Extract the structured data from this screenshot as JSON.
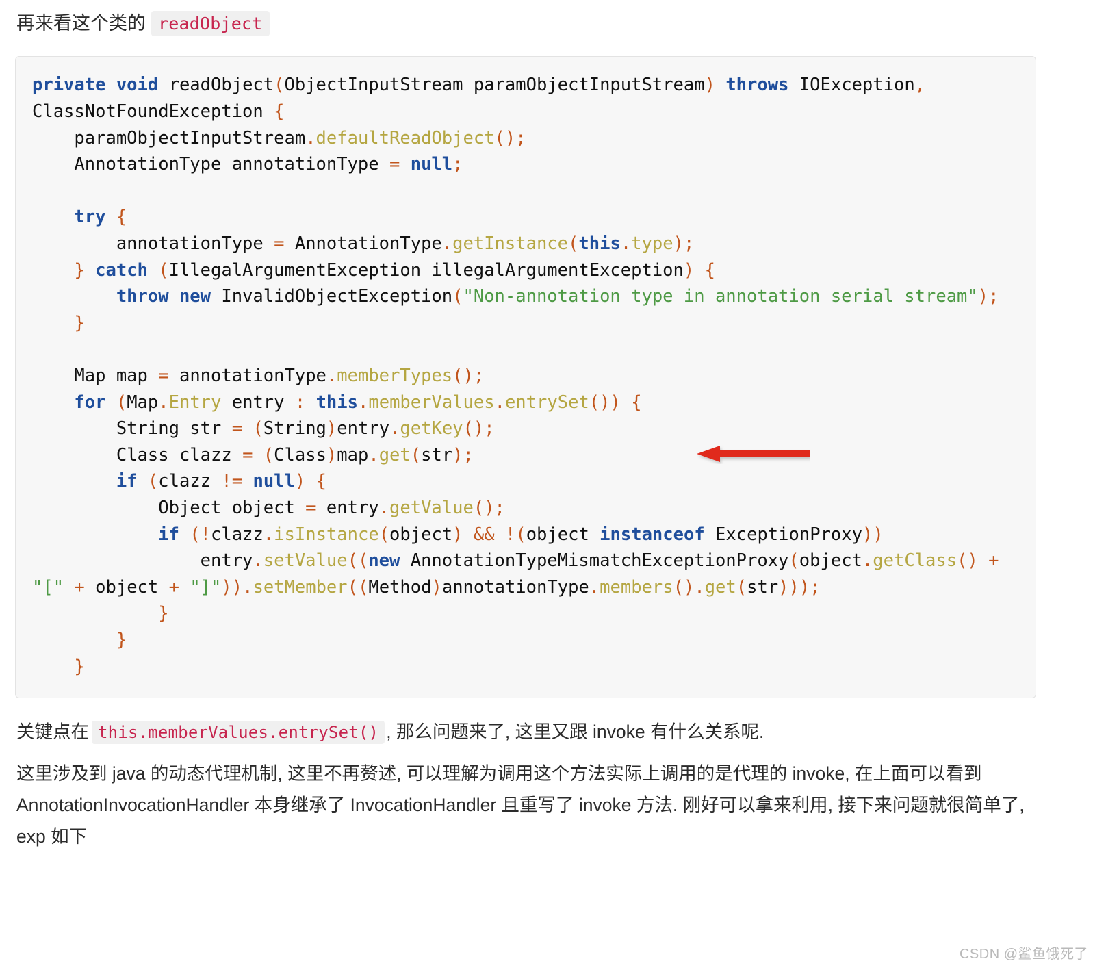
{
  "intro": {
    "text": "再来看这个类的",
    "code": "readObject"
  },
  "code_block": {
    "language": "java",
    "background": "#f7f7f7",
    "colors": {
      "keyword": "#1f4e9c",
      "method": "#b5a642",
      "punctuation": "#c1551c",
      "string": "#4e9a45",
      "plain": "#111111"
    },
    "lines": [
      [
        {
          "t": "private",
          "c": "k"
        },
        {
          "t": " ",
          "c": "t"
        },
        {
          "t": "void",
          "c": "k"
        },
        {
          "t": " readObject",
          "c": "t"
        },
        {
          "t": "(",
          "c": "p"
        },
        {
          "t": "ObjectInputStream paramObjectInputStream",
          "c": "t"
        },
        {
          "t": ")",
          "c": "p"
        },
        {
          "t": " ",
          "c": "t"
        },
        {
          "t": "throws",
          "c": "k"
        },
        {
          "t": " IOException",
          "c": "t"
        },
        {
          "t": ",",
          "c": "p"
        },
        {
          "t": " ClassNotFoundException ",
          "c": "t"
        },
        {
          "t": "{",
          "c": "p"
        }
      ],
      [
        {
          "t": "    paramObjectInputStream",
          "c": "t"
        },
        {
          "t": ".",
          "c": "p"
        },
        {
          "t": "defaultReadObject",
          "c": "fn"
        },
        {
          "t": "();",
          "c": "p"
        }
      ],
      [
        {
          "t": "    AnnotationType annotationType ",
          "c": "t"
        },
        {
          "t": "=",
          "c": "p"
        },
        {
          "t": " ",
          "c": "t"
        },
        {
          "t": "null",
          "c": "k"
        },
        {
          "t": ";",
          "c": "p"
        }
      ],
      [],
      [
        {
          "t": "    ",
          "c": "t"
        },
        {
          "t": "try",
          "c": "k"
        },
        {
          "t": " ",
          "c": "t"
        },
        {
          "t": "{",
          "c": "p"
        }
      ],
      [
        {
          "t": "        annotationType ",
          "c": "t"
        },
        {
          "t": "=",
          "c": "p"
        },
        {
          "t": " AnnotationType",
          "c": "t"
        },
        {
          "t": ".",
          "c": "p"
        },
        {
          "t": "getInstance",
          "c": "fn"
        },
        {
          "t": "(",
          "c": "p"
        },
        {
          "t": "this",
          "c": "k"
        },
        {
          "t": ".",
          "c": "p"
        },
        {
          "t": "type",
          "c": "fn"
        },
        {
          "t": ");",
          "c": "p"
        }
      ],
      [
        {
          "t": "    ",
          "c": "t"
        },
        {
          "t": "}",
          "c": "p"
        },
        {
          "t": " ",
          "c": "t"
        },
        {
          "t": "catch",
          "c": "k"
        },
        {
          "t": " ",
          "c": "t"
        },
        {
          "t": "(",
          "c": "p"
        },
        {
          "t": "IllegalArgumentException illegalArgumentException",
          "c": "t"
        },
        {
          "t": ")",
          "c": "p"
        },
        {
          "t": " ",
          "c": "t"
        },
        {
          "t": "{",
          "c": "p"
        }
      ],
      [
        {
          "t": "        ",
          "c": "t"
        },
        {
          "t": "throw",
          "c": "k"
        },
        {
          "t": " ",
          "c": "t"
        },
        {
          "t": "new",
          "c": "k"
        },
        {
          "t": " InvalidObjectException",
          "c": "t"
        },
        {
          "t": "(",
          "c": "p"
        },
        {
          "t": "\"Non-annotation type in annotation serial stream\"",
          "c": "s"
        },
        {
          "t": ");",
          "c": "p"
        }
      ],
      [
        {
          "t": "    ",
          "c": "t"
        },
        {
          "t": "}",
          "c": "p"
        }
      ],
      [],
      [
        {
          "t": "    Map map ",
          "c": "t"
        },
        {
          "t": "=",
          "c": "p"
        },
        {
          "t": " annotationType",
          "c": "t"
        },
        {
          "t": ".",
          "c": "p"
        },
        {
          "t": "memberTypes",
          "c": "fn"
        },
        {
          "t": "();",
          "c": "p"
        }
      ],
      [
        {
          "t": "    ",
          "c": "t"
        },
        {
          "t": "for",
          "c": "k"
        },
        {
          "t": " ",
          "c": "t"
        },
        {
          "t": "(",
          "c": "p"
        },
        {
          "t": "Map",
          "c": "t"
        },
        {
          "t": ".",
          "c": "p"
        },
        {
          "t": "Entry",
          "c": "fn"
        },
        {
          "t": " entry ",
          "c": "t"
        },
        {
          "t": ":",
          "c": "p"
        },
        {
          "t": " ",
          "c": "t"
        },
        {
          "t": "this",
          "c": "k"
        },
        {
          "t": ".",
          "c": "p"
        },
        {
          "t": "memberValues",
          "c": "fn"
        },
        {
          "t": ".",
          "c": "p"
        },
        {
          "t": "entrySet",
          "c": "fn"
        },
        {
          "t": "())",
          "c": "p"
        },
        {
          "t": " ",
          "c": "t"
        },
        {
          "t": "{",
          "c": "p"
        }
      ],
      [
        {
          "t": "        String str ",
          "c": "t"
        },
        {
          "t": "=",
          "c": "p"
        },
        {
          "t": " ",
          "c": "t"
        },
        {
          "t": "(",
          "c": "p"
        },
        {
          "t": "String",
          "c": "t"
        },
        {
          "t": ")",
          "c": "p"
        },
        {
          "t": "entry",
          "c": "t"
        },
        {
          "t": ".",
          "c": "p"
        },
        {
          "t": "getKey",
          "c": "fn"
        },
        {
          "t": "();",
          "c": "p"
        }
      ],
      [
        {
          "t": "        Class clazz ",
          "c": "t"
        },
        {
          "t": "=",
          "c": "p"
        },
        {
          "t": " ",
          "c": "t"
        },
        {
          "t": "(",
          "c": "p"
        },
        {
          "t": "Class",
          "c": "t"
        },
        {
          "t": ")",
          "c": "p"
        },
        {
          "t": "map",
          "c": "t"
        },
        {
          "t": ".",
          "c": "p"
        },
        {
          "t": "get",
          "c": "fn"
        },
        {
          "t": "(",
          "c": "p"
        },
        {
          "t": "str",
          "c": "t"
        },
        {
          "t": ");",
          "c": "p"
        }
      ],
      [
        {
          "t": "        ",
          "c": "t"
        },
        {
          "t": "if",
          "c": "k"
        },
        {
          "t": " ",
          "c": "t"
        },
        {
          "t": "(",
          "c": "p"
        },
        {
          "t": "clazz ",
          "c": "t"
        },
        {
          "t": "!=",
          "c": "p"
        },
        {
          "t": " ",
          "c": "t"
        },
        {
          "t": "null",
          "c": "k"
        },
        {
          "t": ")",
          "c": "p"
        },
        {
          "t": " ",
          "c": "t"
        },
        {
          "t": "{",
          "c": "p"
        }
      ],
      [
        {
          "t": "            Object object ",
          "c": "t"
        },
        {
          "t": "=",
          "c": "p"
        },
        {
          "t": " entry",
          "c": "t"
        },
        {
          "t": ".",
          "c": "p"
        },
        {
          "t": "getValue",
          "c": "fn"
        },
        {
          "t": "();",
          "c": "p"
        }
      ],
      [
        {
          "t": "            ",
          "c": "t"
        },
        {
          "t": "if",
          "c": "k"
        },
        {
          "t": " ",
          "c": "t"
        },
        {
          "t": "(!",
          "c": "p"
        },
        {
          "t": "clazz",
          "c": "t"
        },
        {
          "t": ".",
          "c": "p"
        },
        {
          "t": "isInstance",
          "c": "fn"
        },
        {
          "t": "(",
          "c": "p"
        },
        {
          "t": "object",
          "c": "t"
        },
        {
          "t": ")",
          "c": "p"
        },
        {
          "t": " ",
          "c": "t"
        },
        {
          "t": "&&",
          "c": "p"
        },
        {
          "t": " ",
          "c": "t"
        },
        {
          "t": "!(",
          "c": "p"
        },
        {
          "t": "object ",
          "c": "t"
        },
        {
          "t": "instanceof",
          "c": "k"
        },
        {
          "t": " ExceptionProxy",
          "c": "t"
        },
        {
          "t": "))",
          "c": "p"
        }
      ],
      [
        {
          "t": "                entry",
          "c": "t"
        },
        {
          "t": ".",
          "c": "p"
        },
        {
          "t": "setValue",
          "c": "fn"
        },
        {
          "t": "((",
          "c": "p"
        },
        {
          "t": "new",
          "c": "k"
        },
        {
          "t": " AnnotationTypeMismatchExceptionProxy",
          "c": "t"
        },
        {
          "t": "(",
          "c": "p"
        },
        {
          "t": "object",
          "c": "t"
        },
        {
          "t": ".",
          "c": "p"
        },
        {
          "t": "getClass",
          "c": "fn"
        },
        {
          "t": "()",
          "c": "p"
        },
        {
          "t": " ",
          "c": "t"
        },
        {
          "t": "+",
          "c": "p"
        },
        {
          "t": " ",
          "c": "t"
        },
        {
          "t": "\"[\"",
          "c": "s"
        },
        {
          "t": " ",
          "c": "t"
        },
        {
          "t": "+",
          "c": "p"
        },
        {
          "t": " object ",
          "c": "t"
        },
        {
          "t": "+",
          "c": "p"
        },
        {
          "t": " ",
          "c": "t"
        },
        {
          "t": "\"]\"",
          "c": "s"
        },
        {
          "t": "))",
          "c": "p"
        },
        {
          "t": ".",
          "c": "p"
        },
        {
          "t": "setMember",
          "c": "fn"
        },
        {
          "t": "((",
          "c": "p"
        },
        {
          "t": "Method",
          "c": "t"
        },
        {
          "t": ")",
          "c": "p"
        },
        {
          "t": "annotationType",
          "c": "t"
        },
        {
          "t": ".",
          "c": "p"
        },
        {
          "t": "members",
          "c": "fn"
        },
        {
          "t": "()",
          "c": "p"
        },
        {
          "t": ".",
          "c": "p"
        },
        {
          "t": "get",
          "c": "fn"
        },
        {
          "t": "(",
          "c": "p"
        },
        {
          "t": "str",
          "c": "t"
        },
        {
          "t": ")));",
          "c": "p"
        }
      ],
      [
        {
          "t": "            ",
          "c": "t"
        },
        {
          "t": "}",
          "c": "p"
        }
      ],
      [
        {
          "t": "        ",
          "c": "t"
        },
        {
          "t": "}",
          "c": "p"
        }
      ],
      [
        {
          "t": "    ",
          "c": "t"
        },
        {
          "t": "}",
          "c": "p"
        }
      ]
    ]
  },
  "annotation": {
    "arrow_color": "#e02a1e",
    "arrow_direction": "left",
    "points_at_line": "for (Map.Entry entry : this.memberValues.entrySet()) {"
  },
  "paragraphs": {
    "line1_a": "关键点在",
    "line1_code": "this.memberValues.entrySet()",
    "line1_b": ", 那么问题来了, 这里又跟 invoke 有什么关系呢.",
    "line2": "这里涉及到 java 的动态代理机制, 这里不再赘述, 可以理解为调用这个方法实际上调用的是代理的 invoke, 在上面可以看到 AnnotationInvocationHandler 本身继承了 InvocationHandler 且重写了 invoke 方法. 刚好可以拿来利用, 接下来问题就很简单了, exp 如下"
  },
  "watermark": "CSDN @鲨鱼饿死了"
}
